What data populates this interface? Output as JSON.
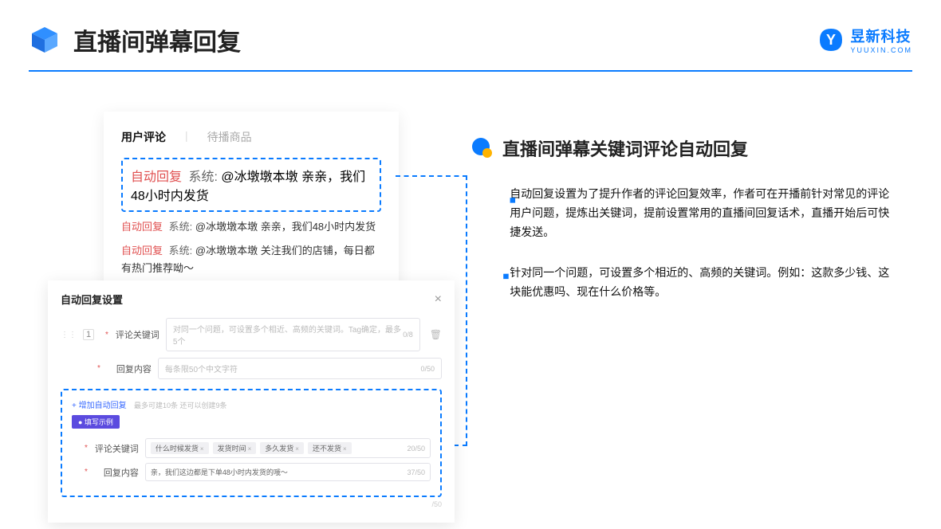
{
  "header": {
    "title": "直播间弹幕回复",
    "logo_cn": "昱新科技",
    "logo_en": "YUUXIN.COM"
  },
  "card1": {
    "tab_active": "用户评论",
    "tab_inactive": "待播商品",
    "comments": [
      {
        "auto": "自动回复",
        "sys": "系统:",
        "text": "@冰墩墩本墩 亲亲，我们48小时内发货"
      },
      {
        "auto": "自动回复",
        "sys": "系统:",
        "text": "@冰墩墩本墩 亲亲，我们48小时内发货"
      },
      {
        "auto": "自动回复",
        "sys": "系统:",
        "text": "@冰墩墩本墩 关注我们的店铺，每日都有热门推荐呦～"
      }
    ]
  },
  "card2": {
    "title": "自动回复设置",
    "row_num": "1",
    "label_keyword": "评论关键词",
    "placeholder_keyword": "对同一个问题，可设置多个相近、高频的关键词。Tag确定，最多5个",
    "counter_keyword": "0/8",
    "label_content": "回复内容",
    "placeholder_content": "每条限50个中文字符",
    "counter_content": "0/50",
    "add_link": "+ 增加自动回复",
    "add_hint": "最多可建10条 还可以创建9条",
    "example_badge": "● 填写示例",
    "example_label_kw": "评论关键词",
    "example_tags": [
      "什么时候发货",
      "发货时间",
      "多久发货",
      "还不发货"
    ],
    "example_kw_counter": "20/50",
    "example_label_content": "回复内容",
    "example_content_val": "亲，我们这边都是下单48小时内发货的哦～",
    "example_content_counter": "37/50",
    "bottom_counter": "/50"
  },
  "right": {
    "title": "直播间弹幕关键词评论自动回复",
    "bullets": [
      "自动回复设置为了提升作者的评论回复效率，作者可在开播前针对常见的评论用户问题，提炼出关键词，提前设置常用的直播间回复话术，直播开始后可快捷发送。",
      "针对同一个问题，可设置多个相近的、高频的关键词。例如：这款多少钱、这块能优惠吗、现在什么价格等。"
    ]
  }
}
